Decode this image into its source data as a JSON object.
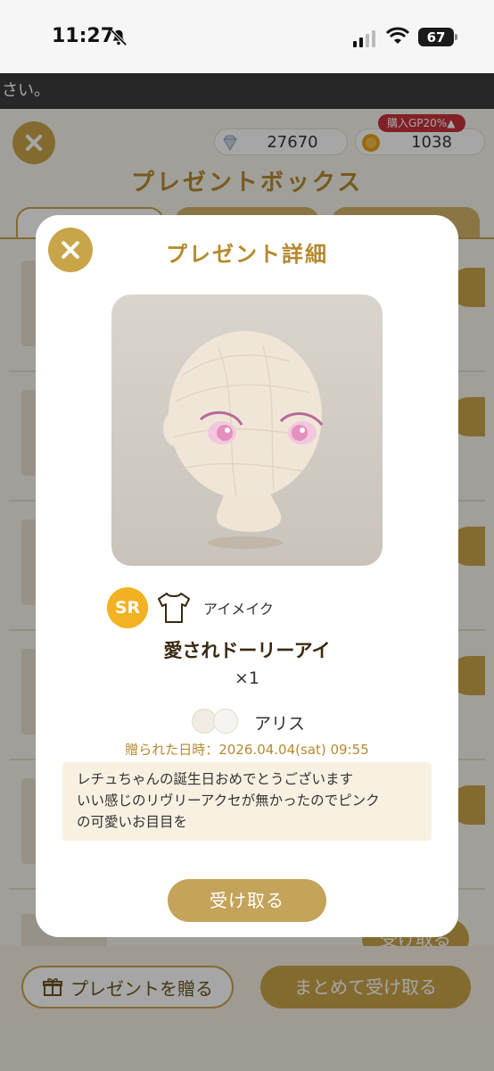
{
  "status_bar": {
    "time": "11:27",
    "battery": "67"
  },
  "background": {
    "notice": "さい。",
    "currency": {
      "gems": "27670",
      "gold": "1038",
      "bonus_badge": "購入GP20%▲"
    },
    "title": "プレゼントボックス",
    "row_receive_label": "受け取る",
    "send_gift_label": "プレゼントを贈る",
    "receive_all_label": "まとめて受け取る"
  },
  "modal": {
    "title": "プレゼント詳細",
    "item": {
      "rarity": "SR",
      "category": "アイメイク",
      "name": "愛されドーリーアイ",
      "quantity": "×1"
    },
    "sender": {
      "name": "アリス",
      "sent_date": "贈られた日時：2026.04.04(sat) 09:55"
    },
    "message": "レチュちゃんの誕生日おめでとうございます\nいい感じのリヴリーアクセが無かったのでピンク\nの可愛いお目目を",
    "receive_label": "受け取る"
  },
  "colors": {
    "accent": "#c9a54a",
    "title_gold": "#b58a2e",
    "rarity_sr": "#f2b221"
  }
}
